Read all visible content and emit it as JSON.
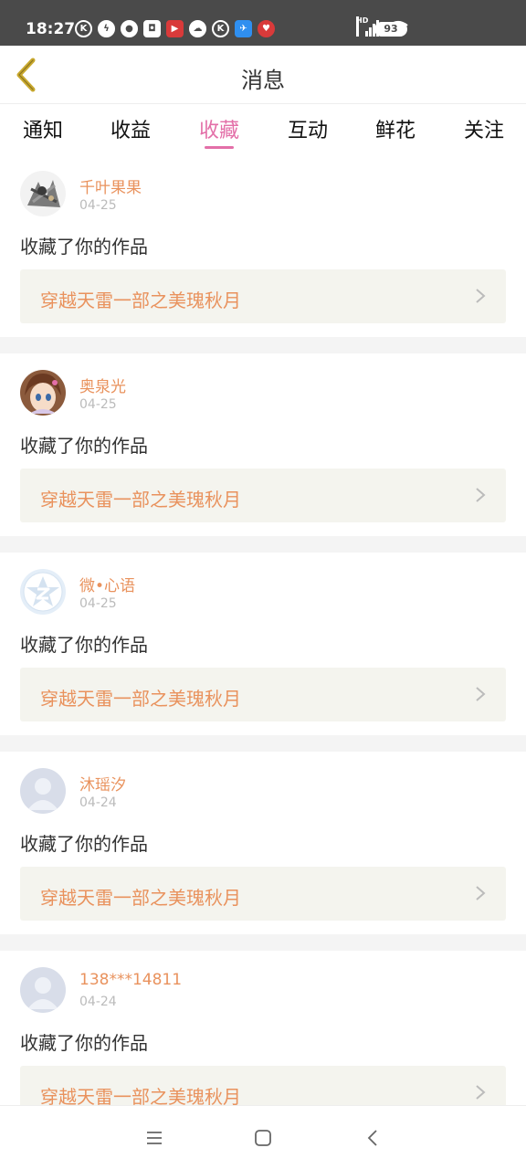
{
  "status_bar": {
    "time": "18:27",
    "icons": [
      "k-icon",
      "bolt-icon",
      "wechat-icon",
      "app-icon",
      "flag-icon",
      "cloud-icon",
      "k-icon",
      "bird-icon",
      "heart-icon"
    ],
    "network": "HD",
    "battery": "93"
  },
  "header": {
    "title": "消息",
    "back_icon": "chevron-left-icon"
  },
  "tabs": [
    {
      "label": "通知",
      "active": false
    },
    {
      "label": "收益",
      "active": false
    },
    {
      "label": "收藏",
      "active": true
    },
    {
      "label": "互动",
      "active": false
    },
    {
      "label": "鲜花",
      "active": false
    },
    {
      "label": "关注",
      "active": false
    }
  ],
  "colors": {
    "accent": "#e36fa8",
    "username": "#e9925d",
    "work_bg": "#f4f4ee"
  },
  "messages": [
    {
      "user": "千叶果果",
      "date": "04-25",
      "action": "收藏了你的作品",
      "work_title": "穿越天雷一部之美瑰秋月",
      "avatar": "anime-group-avatar"
    },
    {
      "user": "奥泉光",
      "date": "04-25",
      "action": "收藏了你的作品",
      "work_title": "穿越天雷一部之美瑰秋月",
      "avatar": "anime-girl-avatar"
    },
    {
      "user": "微•心语",
      "date": "04-25",
      "action": "收藏了你的作品",
      "work_title": "穿越天雷一部之美瑰秋月",
      "avatar": "qzone-avatar"
    },
    {
      "user": "沐瑶汐",
      "date": "04-24",
      "action": "收藏了你的作品",
      "work_title": "穿越天雷一部之美瑰秋月",
      "avatar": "default-avatar"
    },
    {
      "user": "138***14811",
      "date": "04-24",
      "action": "收藏了你的作品",
      "work_title": "穿越天雷一部之美瑰秋月",
      "avatar": "default-avatar"
    }
  ],
  "bottom_nav": [
    "menu-icon",
    "home-icon",
    "back-icon"
  ]
}
